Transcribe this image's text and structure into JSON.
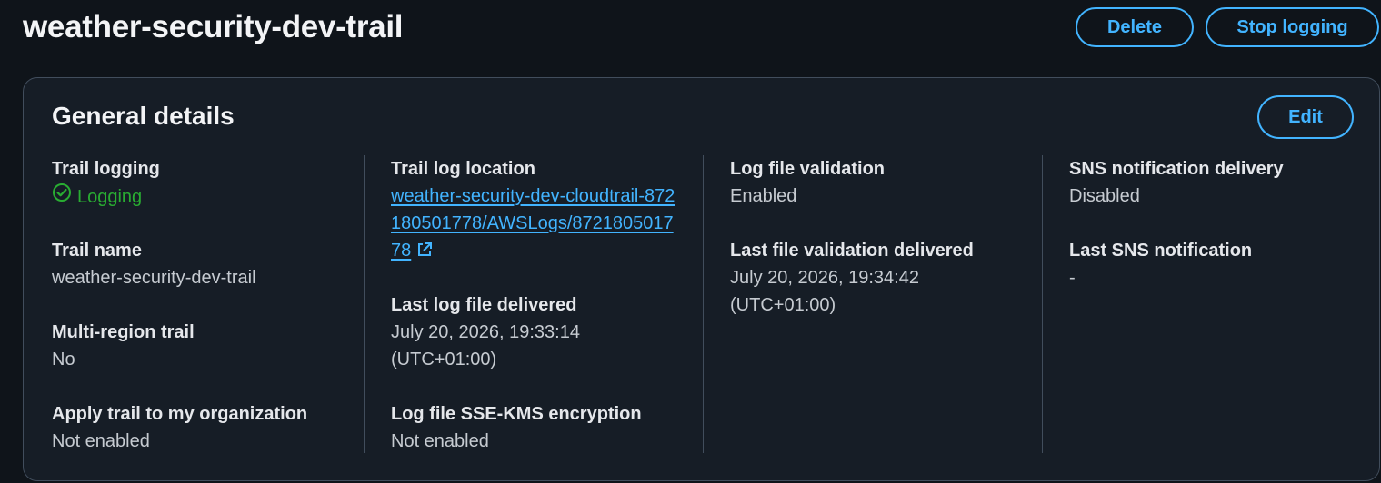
{
  "header": {
    "title": "weather-security-dev-trail",
    "delete_label": "Delete",
    "stop_logging_label": "Stop logging"
  },
  "general_details": {
    "title": "General details",
    "edit_label": "Edit",
    "columns": [
      [
        {
          "label": "Trail logging",
          "value": "Logging",
          "status": "success"
        },
        {
          "label": "Trail name",
          "value": "weather-security-dev-trail"
        },
        {
          "label": "Multi-region trail",
          "value": "No"
        },
        {
          "label": "Apply trail to my organization",
          "value": "Not enabled"
        }
      ],
      [
        {
          "label": "Trail log location",
          "value": "weather-security-dev-cloudtrail-872180501778/AWSLogs/872180501778",
          "link": true,
          "external": true
        },
        {
          "label": "Last log file delivered",
          "value_line1": "July 20, 2026, 19:33:14",
          "value_line2": "(UTC+01:00)"
        },
        {
          "label": "Log file SSE-KMS encryption",
          "value": "Not enabled"
        }
      ],
      [
        {
          "label": "Log file validation",
          "value": "Enabled"
        },
        {
          "label": "Last file validation delivered",
          "value_line1": "July 20, 2026, 19:34:42",
          "value_line2": "(UTC+01:00)"
        }
      ],
      [
        {
          "label": "SNS notification delivery",
          "value": "Disabled"
        },
        {
          "label": "Last SNS notification",
          "value": "-"
        }
      ]
    ]
  },
  "colors": {
    "background": "#0f141a",
    "panel": "#161d26",
    "accent": "#42b4ff",
    "success": "#29ad32",
    "border": "#414d5c"
  },
  "icons": {
    "status": "check-circle-icon",
    "external": "external-link-icon"
  }
}
